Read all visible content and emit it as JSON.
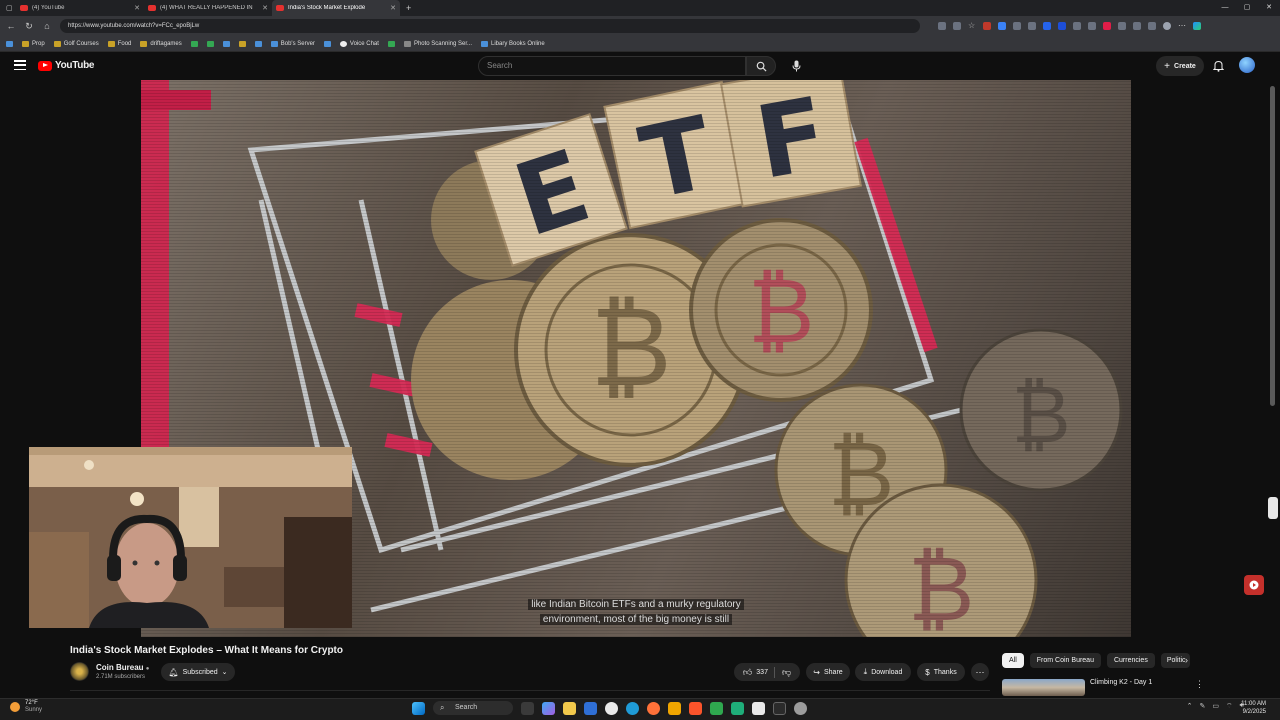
{
  "browser": {
    "tabs": [
      {
        "title": "(4) YouTube",
        "active": false
      },
      {
        "title": "(4) WHAT REALLY HAPPENED IN",
        "active": false
      },
      {
        "title": "India's Stock Market Explode",
        "active": true
      }
    ],
    "url": "https://www.youtube.com/watch?v=FCc_epoBjLw",
    "bookmarks": [
      "Prop",
      "Golf Courses",
      "Food",
      "driftagames",
      "Bob's Server",
      "Voice Chat",
      "Photo Scanning Ser...",
      "Libary Books Online"
    ]
  },
  "youtube": {
    "logo": "YouTube",
    "search_placeholder": "Search",
    "create_label": "Create",
    "video": {
      "title": "India's Stock Market Explodes – What It Means for Crypto",
      "cube_letters": [
        "E",
        "T",
        "F"
      ],
      "subtitle_line1": "like Indian Bitcoin ETFs and a murky regulatory",
      "subtitle_line2": "environment, most of the big money is still"
    },
    "channel": {
      "name": "Coin Bureau",
      "subscribers": "2.71M subscribers",
      "subscribe_state": "Subscribed"
    },
    "actions": {
      "likes": "337",
      "share": "Share",
      "download": "Download",
      "thanks": "Thanks"
    },
    "chips": [
      "All",
      "From Coin Bureau",
      "Currencies",
      "Politic"
    ],
    "recommended": {
      "title": "Climbing K2 - Day 1"
    }
  },
  "taskbar": {
    "weather_temp": "72°F",
    "weather_desc": "Sunny",
    "search_label": "Search",
    "time": "11:00 AM",
    "date": "9/2/2025"
  },
  "colors": {
    "yt_red": "#ff0000",
    "bg": "#0f0f0f",
    "chip_bg": "#272727"
  }
}
